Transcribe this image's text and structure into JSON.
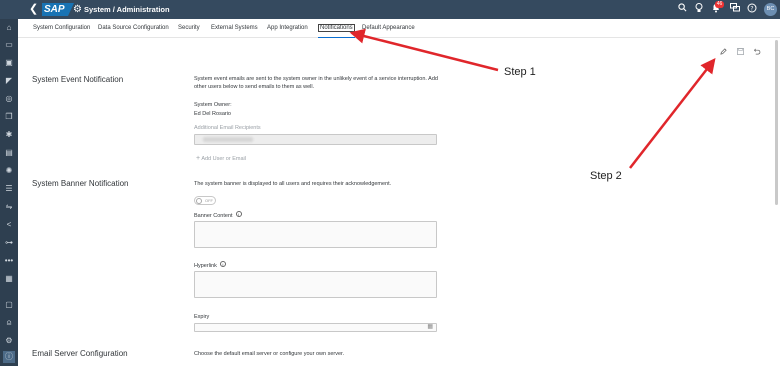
{
  "shell": {
    "back_glyph": "❮",
    "logo_text": "SAP",
    "breadcrumb": "System / Administration",
    "notification_count": "46",
    "avatar_initials": "BC"
  },
  "tabs": [
    {
      "label": "System Configuration"
    },
    {
      "label": "Data Source Configuration"
    },
    {
      "label": "Security"
    },
    {
      "label": "External Systems"
    },
    {
      "label": "App Integration"
    },
    {
      "label": "Notifications",
      "selected": true
    },
    {
      "label": "Default Appearance"
    }
  ],
  "toolbar": {
    "edit_icon": "pencil-icon",
    "save_icon": "save-icon",
    "undo_icon": "undo-icon"
  },
  "event": {
    "title": "System Event Notification",
    "desc_line1": "System event emails are sent to the system owner in the unlikely event of a service interruption. Add",
    "desc_line2": "other users below to send emails to them as well.",
    "owner_label": "System Owner:",
    "owner_name": "Ed Del Rosario",
    "recipients_label": "Additional Email Recipients",
    "add_user": "Add User or Email"
  },
  "banner": {
    "title": "System Banner Notification",
    "desc": "The system banner is displayed to all users and requires their acknowledgement.",
    "toggle_label": "OFF",
    "content_label": "Banner Content",
    "hyperlink_label": "Hyperlink",
    "expiry_label": "Expiry"
  },
  "email": {
    "title": "Email Server Configuration",
    "desc": "Choose the default email server or configure your own server."
  },
  "annotations": {
    "step1": "Step 1",
    "step2": "Step 2",
    "arrow_color": "#e0262b"
  },
  "colors": {
    "shell": "#354a5f",
    "nav": "#2e3f50",
    "accent": "#0a6ed1"
  }
}
